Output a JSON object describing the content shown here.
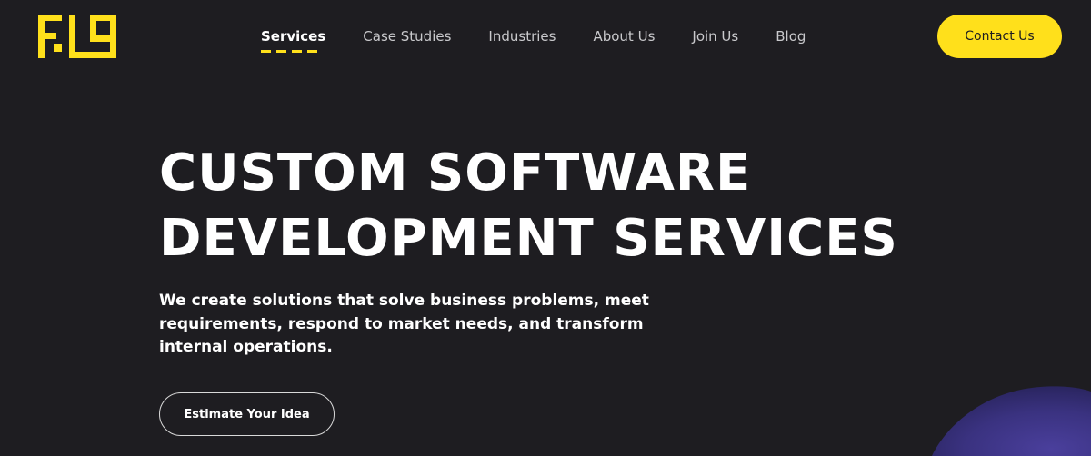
{
  "brand": {
    "accent_color": "#ffe01b",
    "background_color": "#1e1d21"
  },
  "nav": {
    "items": [
      {
        "label": "Services",
        "active": true
      },
      {
        "label": "Case Studies",
        "active": false
      },
      {
        "label": "Industries",
        "active": false
      },
      {
        "label": "About Us",
        "active": false
      },
      {
        "label": "Join Us",
        "active": false
      },
      {
        "label": "Blog",
        "active": false
      }
    ]
  },
  "header": {
    "contact_label": "Contact Us"
  },
  "hero": {
    "title_line1": "CUSTOM SOFTWARE",
    "title_line2": "DEVELOPMENT SERVICES",
    "subtitle": "We create solutions that solve business problems, meet requirements, respond to market needs, and transform internal operations.",
    "cta_label": "Estimate Your Idea"
  }
}
